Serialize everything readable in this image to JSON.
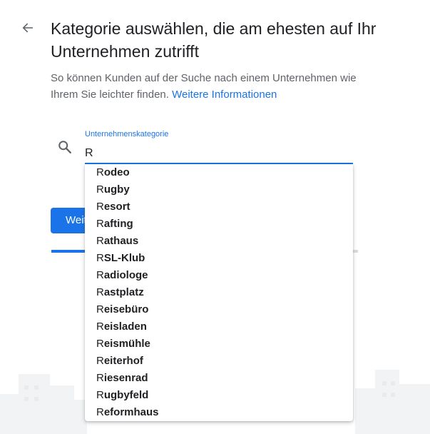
{
  "header": {
    "title": "Kategorie auswählen, die am ehesten auf Ihr Unternehmen zutrifft",
    "subtitle": "So können Kunden auf der Suche nach einem Unternehmen wie Ihrem Sie leichter finden.",
    "more_info_link": "Weitere Informationen",
    "back_icon": "arrow-left-icon"
  },
  "search": {
    "label": "Unternehmenskategorie",
    "value": "R",
    "icon": "search-icon"
  },
  "next_button": {
    "label": "Weiter"
  },
  "progress": {
    "fraction": 0.22
  },
  "colors": {
    "accent": "#1a73e8",
    "text": "#202124",
    "muted": "#5f6368"
  },
  "dropdown": {
    "options": [
      {
        "match": "R",
        "rest": "odeo"
      },
      {
        "match": "R",
        "rest": "ugby"
      },
      {
        "match": "R",
        "rest": "esort"
      },
      {
        "match": "R",
        "rest": "afting"
      },
      {
        "match": "R",
        "rest": "athaus"
      },
      {
        "match": "R",
        "rest": "SL-Klub"
      },
      {
        "match": "R",
        "rest": "adiologe"
      },
      {
        "match": "R",
        "rest": "astplatz"
      },
      {
        "match": "R",
        "rest": "eisebüro"
      },
      {
        "match": "R",
        "rest": "eisladen"
      },
      {
        "match": "R",
        "rest": "eismühle"
      },
      {
        "match": "R",
        "rest": "eiterhof"
      },
      {
        "match": "R",
        "rest": "iesenrad"
      },
      {
        "match": "R",
        "rest": "ugbyfeld"
      },
      {
        "match": "R",
        "rest": "eformhaus"
      }
    ]
  }
}
